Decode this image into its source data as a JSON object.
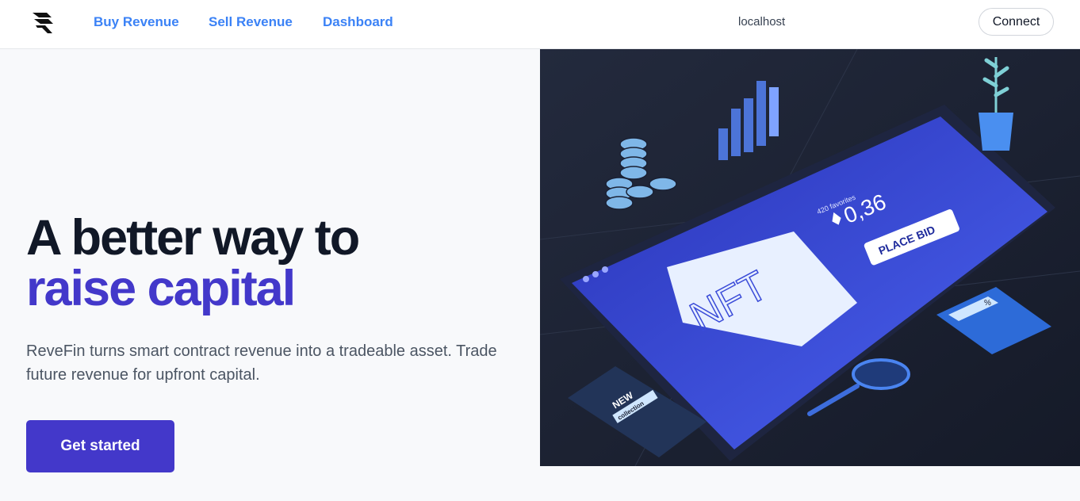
{
  "nav": {
    "logo": "revefin-logo",
    "links": [
      {
        "label": "Buy Revenue"
      },
      {
        "label": "Sell Revenue"
      },
      {
        "label": "Dashboard"
      }
    ],
    "host": "localhost",
    "connect_label": "Connect"
  },
  "hero": {
    "headline_line1": "A better way to",
    "headline_line2": "raise capital",
    "subtext": "ReveFin turns smart contract revenue into a tradeable asset. Trade future revenue for upfront capital.",
    "cta_label": "Get started",
    "illustration": {
      "price": "0,36",
      "favorites": "420 favorites",
      "bid_label": "PLACE BID",
      "nft_label": "NFT",
      "phone_label_1": "NEW",
      "phone_label_2": "collection",
      "calc_label": "%"
    }
  },
  "colors": {
    "accent": "#4338ca",
    "link": "#3b82f6",
    "image_bg": "#1a2033"
  }
}
